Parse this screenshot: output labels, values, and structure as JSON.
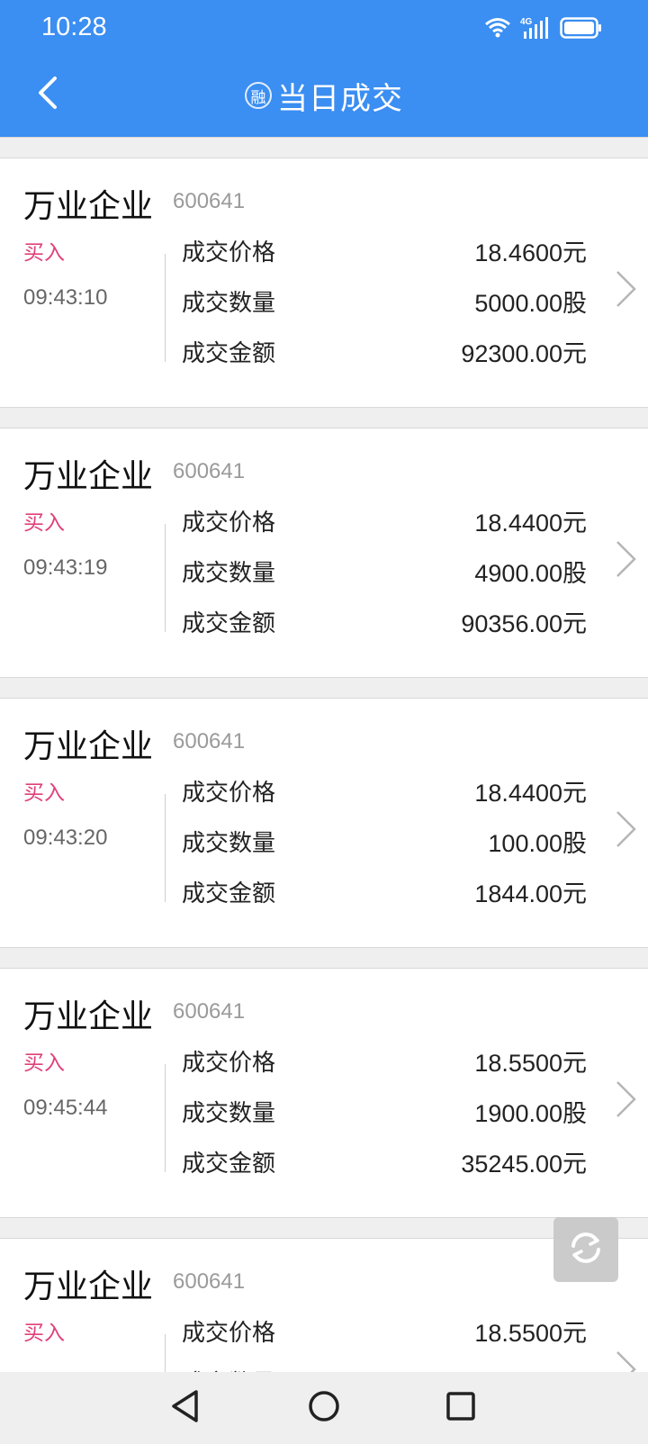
{
  "status_bar": {
    "time": "10:28",
    "icons": [
      "wifi-icon",
      "4g-signal-icon",
      "battery-icon"
    ]
  },
  "header": {
    "badge": "融",
    "title": "当日成交",
    "back_icon": "chevron-left-icon",
    "color": "#3b8ef2"
  },
  "labels": {
    "price": "成交价格",
    "qty": "成交数量",
    "amount": "成交金额"
  },
  "side_color": "#e0407a",
  "trades": [
    {
      "name": "万业企业",
      "code": "600641",
      "side": "买入",
      "time": "09:43:10",
      "price": "18.4600元",
      "qty": "5000.00股",
      "amount": "92300.00元"
    },
    {
      "name": "万业企业",
      "code": "600641",
      "side": "买入",
      "time": "09:43:19",
      "price": "18.4400元",
      "qty": "4900.00股",
      "amount": "90356.00元"
    },
    {
      "name": "万业企业",
      "code": "600641",
      "side": "买入",
      "time": "09:43:20",
      "price": "18.4400元",
      "qty": "100.00股",
      "amount": "1844.00元"
    },
    {
      "name": "万业企业",
      "code": "600641",
      "side": "买入",
      "time": "09:45:44",
      "price": "18.5500元",
      "qty": "1900.00股",
      "amount": "35245.00元"
    },
    {
      "name": "万业企业",
      "code": "600641",
      "side": "买入",
      "time": "",
      "price": "18.5500元",
      "qty": "",
      "amount": ""
    }
  ],
  "floating_button": {
    "icon": "refresh-icon"
  },
  "nav_bar": {
    "icons": [
      "back-triangle-icon",
      "home-circle-icon",
      "recents-square-icon"
    ]
  }
}
